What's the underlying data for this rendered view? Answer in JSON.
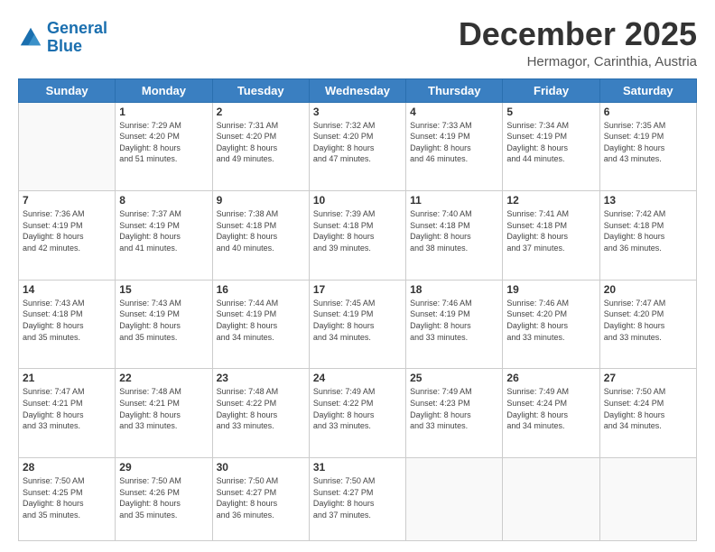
{
  "header": {
    "logo": {
      "line1": "General",
      "line2": "Blue"
    },
    "title": "December 2025",
    "subtitle": "Hermagor, Carinthia, Austria"
  },
  "calendar": {
    "days_of_week": [
      "Sunday",
      "Monday",
      "Tuesday",
      "Wednesday",
      "Thursday",
      "Friday",
      "Saturday"
    ],
    "weeks": [
      [
        {
          "day": "",
          "info": ""
        },
        {
          "day": "1",
          "info": "Sunrise: 7:29 AM\nSunset: 4:20 PM\nDaylight: 8 hours\nand 51 minutes."
        },
        {
          "day": "2",
          "info": "Sunrise: 7:31 AM\nSunset: 4:20 PM\nDaylight: 8 hours\nand 49 minutes."
        },
        {
          "day": "3",
          "info": "Sunrise: 7:32 AM\nSunset: 4:20 PM\nDaylight: 8 hours\nand 47 minutes."
        },
        {
          "day": "4",
          "info": "Sunrise: 7:33 AM\nSunset: 4:19 PM\nDaylight: 8 hours\nand 46 minutes."
        },
        {
          "day": "5",
          "info": "Sunrise: 7:34 AM\nSunset: 4:19 PM\nDaylight: 8 hours\nand 44 minutes."
        },
        {
          "day": "6",
          "info": "Sunrise: 7:35 AM\nSunset: 4:19 PM\nDaylight: 8 hours\nand 43 minutes."
        }
      ],
      [
        {
          "day": "7",
          "info": "Sunrise: 7:36 AM\nSunset: 4:19 PM\nDaylight: 8 hours\nand 42 minutes."
        },
        {
          "day": "8",
          "info": "Sunrise: 7:37 AM\nSunset: 4:19 PM\nDaylight: 8 hours\nand 41 minutes."
        },
        {
          "day": "9",
          "info": "Sunrise: 7:38 AM\nSunset: 4:18 PM\nDaylight: 8 hours\nand 40 minutes."
        },
        {
          "day": "10",
          "info": "Sunrise: 7:39 AM\nSunset: 4:18 PM\nDaylight: 8 hours\nand 39 minutes."
        },
        {
          "day": "11",
          "info": "Sunrise: 7:40 AM\nSunset: 4:18 PM\nDaylight: 8 hours\nand 38 minutes."
        },
        {
          "day": "12",
          "info": "Sunrise: 7:41 AM\nSunset: 4:18 PM\nDaylight: 8 hours\nand 37 minutes."
        },
        {
          "day": "13",
          "info": "Sunrise: 7:42 AM\nSunset: 4:18 PM\nDaylight: 8 hours\nand 36 minutes."
        }
      ],
      [
        {
          "day": "14",
          "info": "Sunrise: 7:43 AM\nSunset: 4:18 PM\nDaylight: 8 hours\nand 35 minutes."
        },
        {
          "day": "15",
          "info": "Sunrise: 7:43 AM\nSunset: 4:19 PM\nDaylight: 8 hours\nand 35 minutes."
        },
        {
          "day": "16",
          "info": "Sunrise: 7:44 AM\nSunset: 4:19 PM\nDaylight: 8 hours\nand 34 minutes."
        },
        {
          "day": "17",
          "info": "Sunrise: 7:45 AM\nSunset: 4:19 PM\nDaylight: 8 hours\nand 34 minutes."
        },
        {
          "day": "18",
          "info": "Sunrise: 7:46 AM\nSunset: 4:19 PM\nDaylight: 8 hours\nand 33 minutes."
        },
        {
          "day": "19",
          "info": "Sunrise: 7:46 AM\nSunset: 4:20 PM\nDaylight: 8 hours\nand 33 minutes."
        },
        {
          "day": "20",
          "info": "Sunrise: 7:47 AM\nSunset: 4:20 PM\nDaylight: 8 hours\nand 33 minutes."
        }
      ],
      [
        {
          "day": "21",
          "info": "Sunrise: 7:47 AM\nSunset: 4:21 PM\nDaylight: 8 hours\nand 33 minutes."
        },
        {
          "day": "22",
          "info": "Sunrise: 7:48 AM\nSunset: 4:21 PM\nDaylight: 8 hours\nand 33 minutes."
        },
        {
          "day": "23",
          "info": "Sunrise: 7:48 AM\nSunset: 4:22 PM\nDaylight: 8 hours\nand 33 minutes."
        },
        {
          "day": "24",
          "info": "Sunrise: 7:49 AM\nSunset: 4:22 PM\nDaylight: 8 hours\nand 33 minutes."
        },
        {
          "day": "25",
          "info": "Sunrise: 7:49 AM\nSunset: 4:23 PM\nDaylight: 8 hours\nand 33 minutes."
        },
        {
          "day": "26",
          "info": "Sunrise: 7:49 AM\nSunset: 4:24 PM\nDaylight: 8 hours\nand 34 minutes."
        },
        {
          "day": "27",
          "info": "Sunrise: 7:50 AM\nSunset: 4:24 PM\nDaylight: 8 hours\nand 34 minutes."
        }
      ],
      [
        {
          "day": "28",
          "info": "Sunrise: 7:50 AM\nSunset: 4:25 PM\nDaylight: 8 hours\nand 35 minutes."
        },
        {
          "day": "29",
          "info": "Sunrise: 7:50 AM\nSunset: 4:26 PM\nDaylight: 8 hours\nand 35 minutes."
        },
        {
          "day": "30",
          "info": "Sunrise: 7:50 AM\nSunset: 4:27 PM\nDaylight: 8 hours\nand 36 minutes."
        },
        {
          "day": "31",
          "info": "Sunrise: 7:50 AM\nSunset: 4:27 PM\nDaylight: 8 hours\nand 37 minutes."
        },
        {
          "day": "",
          "info": ""
        },
        {
          "day": "",
          "info": ""
        },
        {
          "day": "",
          "info": ""
        }
      ]
    ]
  }
}
